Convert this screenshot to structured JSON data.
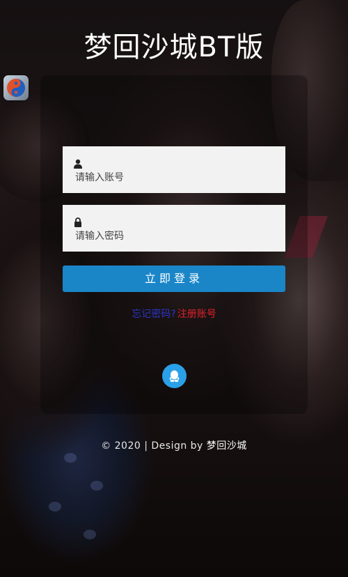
{
  "header": {
    "title": "梦回沙城BT版"
  },
  "app": {
    "icon": "yin-yang-icon"
  },
  "form": {
    "account": {
      "icon": "user-icon",
      "placeholder": "请输入账号",
      "value": ""
    },
    "password": {
      "icon": "lock-icon",
      "placeholder": "请输入密码",
      "value": ""
    },
    "login_label": "立即登录"
  },
  "links": {
    "forgot": "忘记密码?",
    "register": "注册账号"
  },
  "social": {
    "qq_icon": "qq-penguin-icon"
  },
  "footer": {
    "prefix": "© 2020 | Design by ",
    "brand": "梦回沙城"
  },
  "colors": {
    "accent": "#1a86c8",
    "register_link": "#e0202a",
    "forgot_link": "#2b35c9",
    "qq": "#2aa0e8"
  }
}
